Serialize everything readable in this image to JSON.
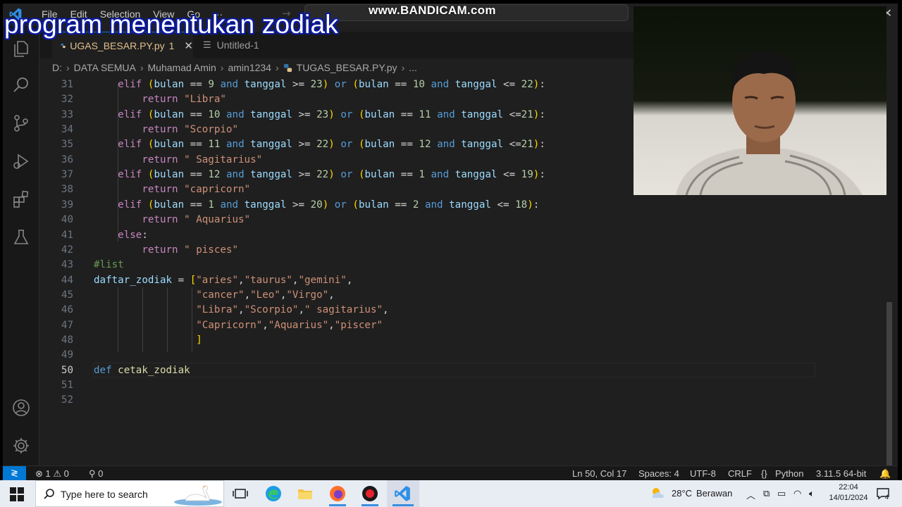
{
  "overlay": {
    "title": "program menentukan zodiak",
    "watermark": "www.BANDICAM.com"
  },
  "menu": [
    "File",
    "Edit",
    "Selection",
    "View",
    "Go",
    "···"
  ],
  "tabs": [
    {
      "label": "UGAS_BESAR.PY.py",
      "badge": "1",
      "active": true
    },
    {
      "label": "Untitled-1",
      "active": false
    }
  ],
  "breadcrumb": [
    "D:",
    "DATA SEMUA",
    "Muhamad Amin",
    "amin1234",
    "TUGAS_BESAR.PY.py",
    "..."
  ],
  "editor": {
    "language": "python",
    "current_line": 50,
    "lines": [
      {
        "n": "31",
        "text": "    elif (bulan == 9 and tanggal >= 23) or (bulan == 10 and tanggal <= 22):"
      },
      {
        "n": "32",
        "text": "        return \"Libra\""
      },
      {
        "n": "33",
        "text": "    elif (bulan == 10 and tanggal >= 23) or (bulan == 11 and tanggal <=21):"
      },
      {
        "n": "34",
        "text": "        return \"Scorpio\""
      },
      {
        "n": "35",
        "text": "    elif (bulan == 11 and tanggal >= 22) or (bulan == 12 and tanggal <=21):"
      },
      {
        "n": "36",
        "text": "        return \" Sagitarius\""
      },
      {
        "n": "37",
        "text": "    elif (bulan == 12 and tanggal >= 22) or (bulan == 1 and tanggal <= 19):"
      },
      {
        "n": "38",
        "text": "        return \"capricorn\""
      },
      {
        "n": "39",
        "text": "    elif (bulan == 1 and tanggal >= 20) or (bulan == 2 and tanggal <= 18):"
      },
      {
        "n": "40",
        "text": "        return \" Aquarius\""
      },
      {
        "n": "41",
        "text": "    else:"
      },
      {
        "n": "42",
        "text": "        return \" pisces\""
      },
      {
        "n": "43",
        "text": "#list"
      },
      {
        "n": "44",
        "text": "daftar_zodiak = [\"aries\",\"taurus\",\"gemini\","
      },
      {
        "n": "45",
        "text": "                 \"cancer\",\"Leo\",\"Virgo\","
      },
      {
        "n": "46",
        "text": "                 \"Libra\",\"Scorpio\",\" sagitarius\","
      },
      {
        "n": "47",
        "text": "                 \"Capricorn\",\"Aquarius\",\"piscer\""
      },
      {
        "n": "48",
        "text": "                 ]"
      },
      {
        "n": "49",
        "text": ""
      },
      {
        "n": "50",
        "text": "def cetak_zodiak"
      },
      {
        "n": "51",
        "text": ""
      },
      {
        "n": "52",
        "text": ""
      }
    ]
  },
  "statusbar": {
    "errors": "1",
    "warnings": "0",
    "ports": "0",
    "position": "Ln 50, Col 17",
    "spaces": "Spaces: 4",
    "encoding": "UTF-8",
    "eol": "CRLF",
    "language": "Python",
    "interpreter": "3.11.5 64-bit"
  },
  "taskbar": {
    "search_placeholder": "Type here to search",
    "weather_temp": "28°C",
    "weather_text": "Berawan",
    "time": "22:04",
    "date": "14/01/2024",
    "notification_count": "4"
  },
  "colors": {
    "editor_bg": "#1f1f1f",
    "accent": "#0078d4",
    "keyword": "#c586c0",
    "keyword_blue": "#569cd6",
    "variable": "#9cdcfe",
    "string": "#ce9178",
    "number": "#b5cea8",
    "comment": "#6a9955"
  }
}
